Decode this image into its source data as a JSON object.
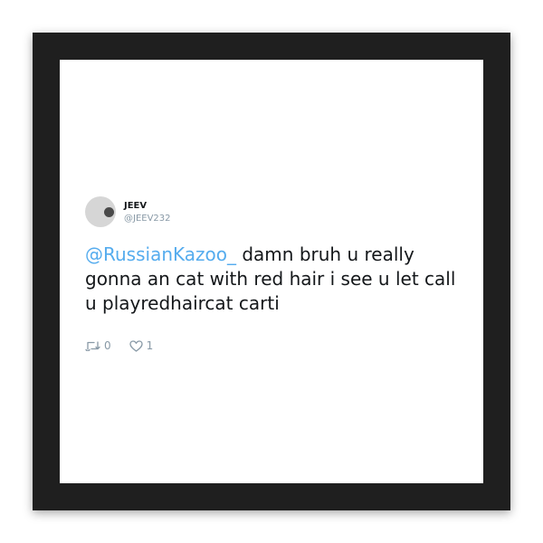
{
  "tweet": {
    "display_name": "JEEV",
    "handle": "@JEEV232",
    "mention": "@RussianKazoo_",
    "text": " damn bruh u really gonna an cat with red hair i see u let call u playredhaircat carti",
    "retweet_count": "0",
    "like_count": "1"
  },
  "icons": {
    "retweet": "retweet-icon",
    "like": "heart-icon",
    "avatar": "avatar"
  },
  "colors": {
    "mention": "#55acee",
    "frame": "#1f1f1f",
    "muted": "#8899a6"
  }
}
